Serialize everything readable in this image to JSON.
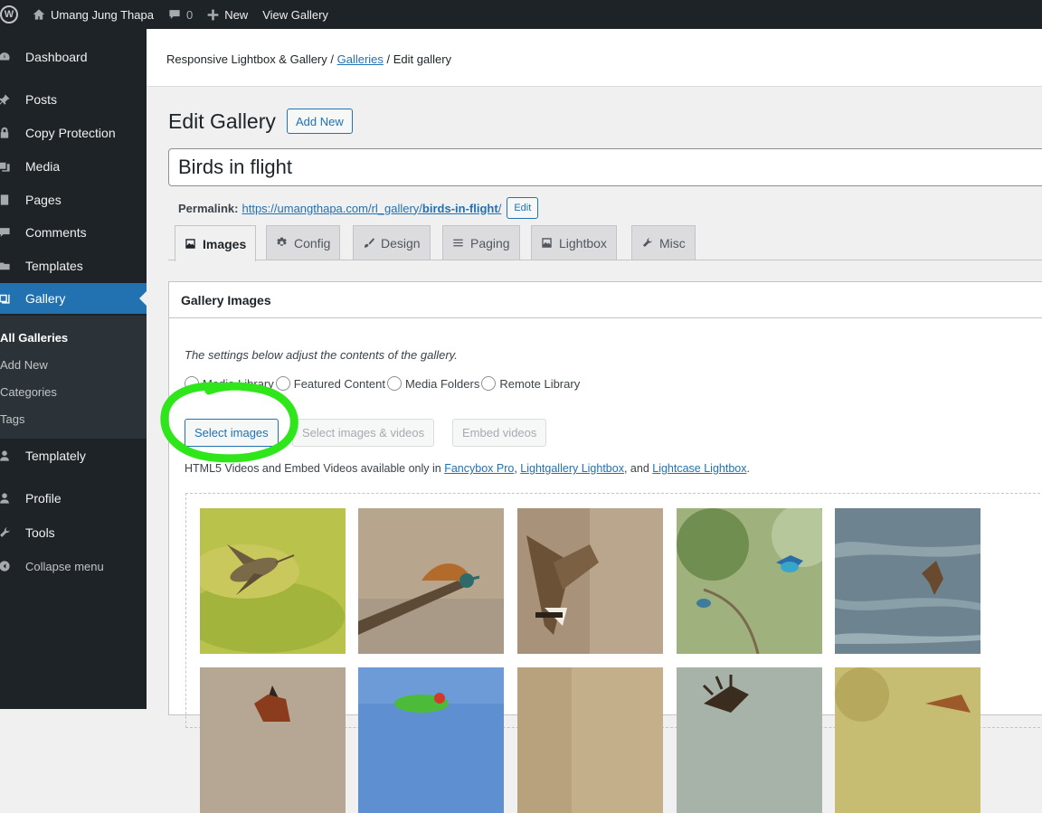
{
  "admin_bar": {
    "site_name": "Umang Jung Thapa",
    "comments_count": "0",
    "new_label": "New",
    "view_label": "View Gallery"
  },
  "menu": {
    "items": [
      {
        "label": "Dashboard",
        "icon": "dashboard-icon"
      },
      {
        "label": "Posts",
        "icon": "pin-icon"
      },
      {
        "label": "Copy Protection",
        "icon": "lock-icon"
      },
      {
        "label": "Media",
        "icon": "media-icon"
      },
      {
        "label": "Pages",
        "icon": "page-icon"
      },
      {
        "label": "Comments",
        "icon": "comment-icon"
      },
      {
        "label": "Templates",
        "icon": "folder-icon"
      },
      {
        "label": "Gallery",
        "icon": "gallery-icon"
      },
      {
        "label": "Templately",
        "icon": "templately-icon"
      },
      {
        "label": "Profile",
        "icon": "user-icon"
      },
      {
        "label": "Tools",
        "icon": "wrench-icon"
      },
      {
        "label": "Collapse menu",
        "icon": "collapse-icon"
      }
    ],
    "submenu": [
      "All Galleries",
      "Add New",
      "Categories",
      "Tags"
    ]
  },
  "breadcrumb": {
    "root": "Responsive Lightbox & Gallery",
    "sep": " / ",
    "link": "Galleries",
    "current": "Edit gallery"
  },
  "page": {
    "title": "Edit Gallery",
    "add_new": "Add New",
    "gallery_title": "Birds in flight",
    "permalink_label": "Permalink:",
    "permalink_base": "https://umangthapa.com/rl_gallery/",
    "permalink_slug": "birds-in-flight",
    "permalink_end": "/",
    "edit_label": "Edit"
  },
  "tabs": [
    "Images",
    "Config",
    "Design",
    "Paging",
    "Lightbox",
    "Misc"
  ],
  "gallery_images": {
    "header": "Gallery Images",
    "note": "The settings below adjust the contents of the gallery.",
    "sources": [
      "Media Library",
      "Featured Content",
      "Media Folders",
      "Remote Library"
    ],
    "select_images": "Select images",
    "select_images_videos": "Select images & videos",
    "embed_videos": "Embed videos",
    "html5_note_pre": "HTML5 Videos and Embed Videos available only in ",
    "link1": "Fancybox Pro",
    "sep1": ", ",
    "link2": "Lightgallery Lightbox",
    "sep2": ", and ",
    "link3": "Lightcase Lightbox",
    "end": "."
  },
  "colors": {
    "admin_dark": "#1d2327",
    "accent": "#2271b1",
    "highlight": "#2ee61a"
  }
}
